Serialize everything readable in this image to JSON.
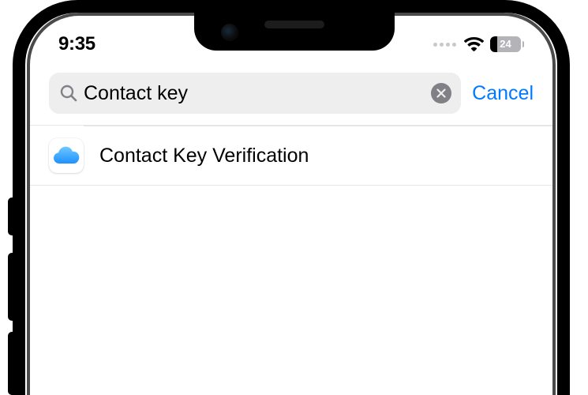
{
  "status_bar": {
    "time": "9:35",
    "battery_level": "24"
  },
  "search": {
    "query": "Contact key",
    "cancel_label": "Cancel"
  },
  "results": [
    {
      "icon": "icloud",
      "label": "Contact Key Verification"
    }
  ]
}
